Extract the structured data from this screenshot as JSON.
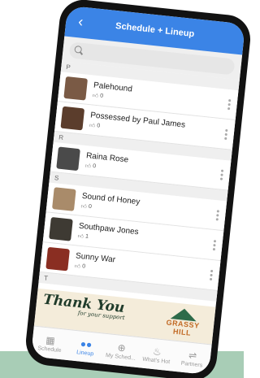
{
  "header": {
    "title": "Schedule + Lineup",
    "back_glyph": "‹"
  },
  "search": {
    "icon": "search-icon"
  },
  "sections": [
    {
      "letter": "P",
      "artists": [
        {
          "name": "Palehound",
          "likes": "0",
          "color": "#7a5a45"
        },
        {
          "name": "Possessed by Paul James",
          "likes": "0",
          "color": "#5b3d2c"
        }
      ]
    },
    {
      "letter": "R",
      "artists": [
        {
          "name": "Raina Rose",
          "likes": "0",
          "color": "#4a4a4a"
        }
      ]
    },
    {
      "letter": "S",
      "artists": [
        {
          "name": "Sound of Honey",
          "likes": "0",
          "color": "#a98b6a"
        },
        {
          "name": "Southpaw Jones",
          "likes": "1",
          "color": "#3e3a33"
        },
        {
          "name": "Sunny War",
          "likes": "0",
          "color": "#8a2e22"
        }
      ]
    },
    {
      "letter": "T",
      "artists": []
    }
  ],
  "banner": {
    "thank_you": "Thank You",
    "support": "for your support",
    "logo_text": "GRASSY HILL"
  },
  "tabs": [
    {
      "label": "Schedule",
      "icon": "calendar-icon",
      "glyph": "▦",
      "active": false
    },
    {
      "label": "Lineup",
      "icon": "people-icon",
      "glyph": "●●",
      "active": true
    },
    {
      "label": "My Sched...",
      "icon": "plus-circle-icon",
      "glyph": "⊕",
      "active": false
    },
    {
      "label": "What's Hot",
      "icon": "flame-icon",
      "glyph": "♨",
      "active": false
    },
    {
      "label": "Partners",
      "icon": "handshake-icon",
      "glyph": "⇌",
      "active": false
    }
  ]
}
